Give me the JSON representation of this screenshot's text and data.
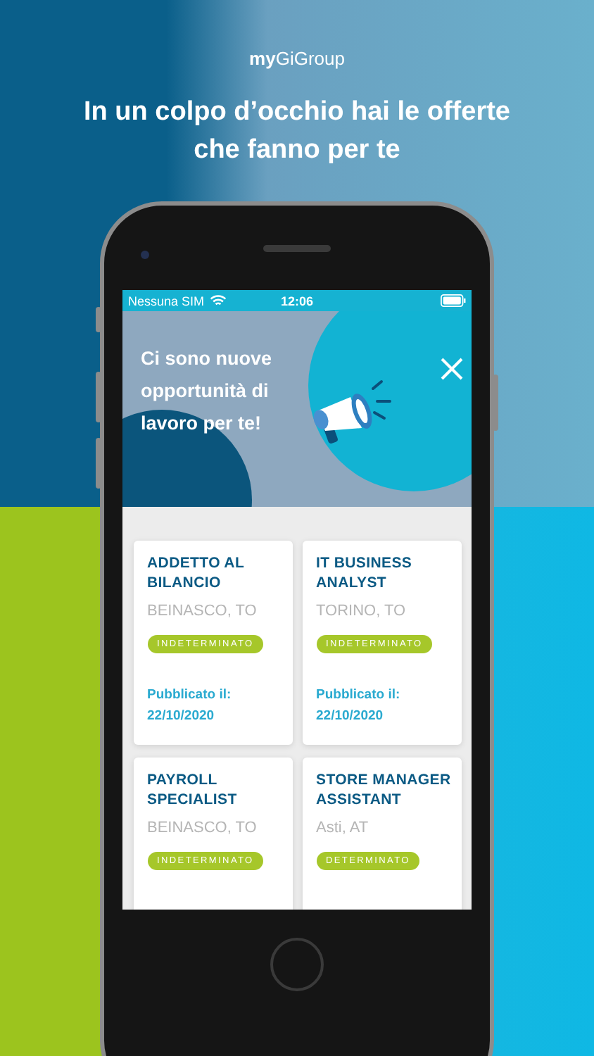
{
  "brand": "**my**GiGroup",
  "headline": [
    "In un colpo d’occhio hai le offerte",
    "che fanno per te"
  ],
  "status_bar": {
    "carrier": "Nessuna SIM",
    "time": "12:06"
  },
  "banner": {
    "title": "Ci sono nuove opportunità di lavoro per te!"
  },
  "jobs": [
    {
      "title": "ADDETTO AL BILANCIO",
      "location": "BEINASCO, TO",
      "contract": "INDETERMINATO",
      "published_label": "Pubblicato il:",
      "date": "22/10/2020"
    },
    {
      "title": "IT BUSINESS ANALYST",
      "location": "TORINO, TO",
      "contract": "INDETERMINATO",
      "published_label": "Pubblicato il:",
      "date": "22/10/2020"
    },
    {
      "title": "PAYROLL SPECIALIST",
      "location": "BEINASCO, TO",
      "contract": "INDETERMINATO"
    },
    {
      "title": "STORE MANAGER ASSISTANT",
      "location": "Asti, AT",
      "contract": "DETERMINATO"
    }
  ]
}
